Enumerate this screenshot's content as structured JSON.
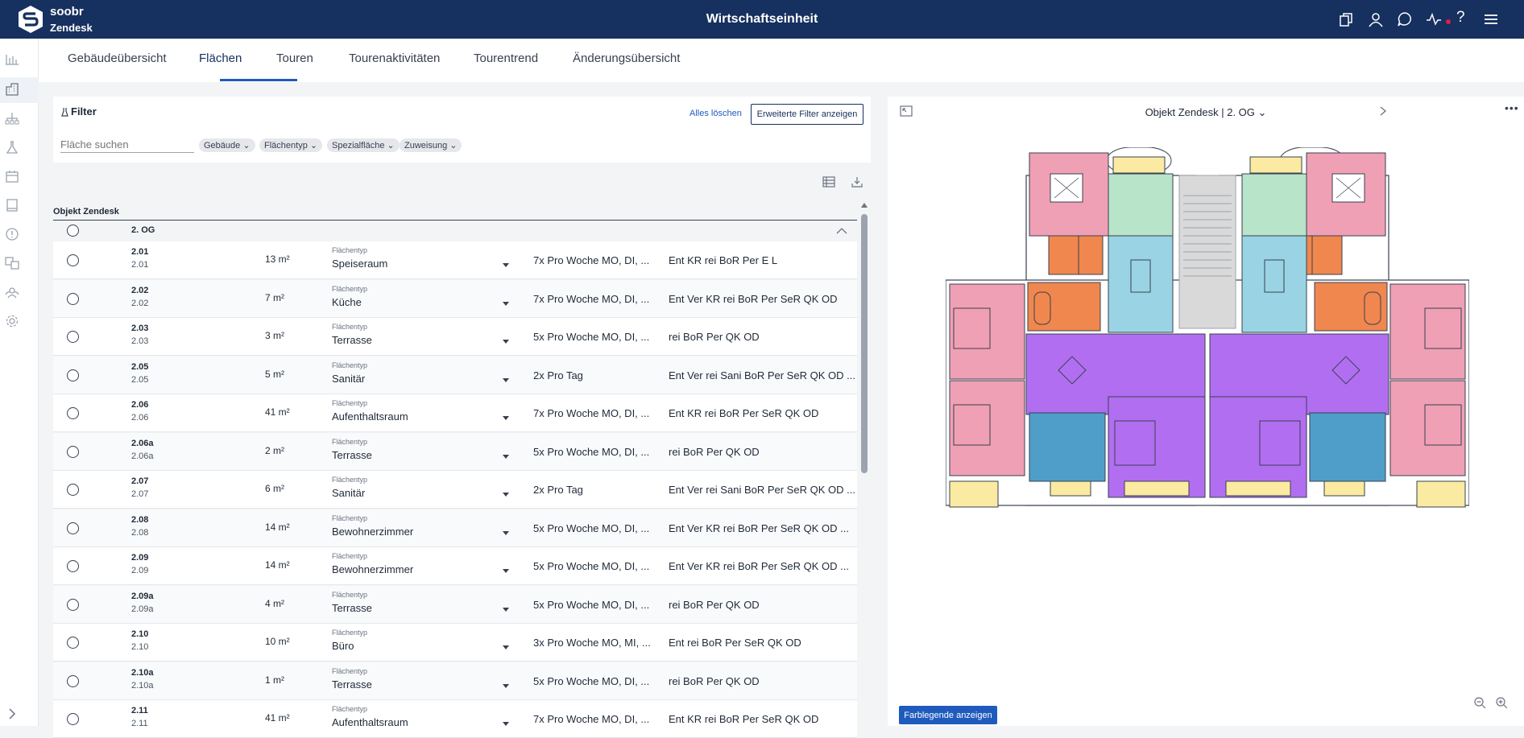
{
  "app": {
    "brand_line1": "soobr",
    "brand_line2": "Zendesk",
    "title": "Wirtschaftseinheit"
  },
  "colors": {
    "topbar": "#16305f",
    "accent": "#1f5bbd",
    "notification_dot": "#e11d48"
  },
  "topbar_icons": [
    "copy-icon",
    "user-icon",
    "chat-icon",
    "activity-icon",
    "help-icon",
    "menu-icon"
  ],
  "topbar_help": "?",
  "sidebar_icons": [
    "chart-icon",
    "building-icon",
    "hierarchy-icon",
    "lab-flask-icon",
    "calendar-icon",
    "book-icon",
    "info-icon",
    "translate-icon",
    "people-icon",
    "settings-icon",
    "expand-chevron-icon"
  ],
  "tabs": [
    {
      "label": "Gebäudeübersicht"
    },
    {
      "label": "Flächen"
    },
    {
      "label": "Touren"
    },
    {
      "label": "Tourenaktivitäten"
    },
    {
      "label": "Tourentrend"
    },
    {
      "label": "Änderungsübersicht"
    }
  ],
  "active_tab": "Flächen",
  "filter": {
    "title": "Filter",
    "clear_all": "Alles löschen",
    "advanced": "Erweiterte Filter anzeigen",
    "search_placeholder": "Fläche suchen",
    "chips": [
      {
        "label": "Gebäude"
      },
      {
        "label": "Flächentyp"
      },
      {
        "label": "Spezialfläche"
      },
      {
        "label": "Zuweisung"
      }
    ]
  },
  "list": {
    "object_header": "Objekt Zendesk",
    "floor": "2. OG",
    "type_label": "Flächentyp",
    "rows": [
      {
        "code": "2.01",
        "sub": "2.01",
        "area": "13 m²",
        "type": "Speiseraum",
        "freq": "7x Pro Woche MO, DI, ...",
        "acts": "Ent KR rei BoR Per E L"
      },
      {
        "code": "2.02",
        "sub": "2.02",
        "area": "7 m²",
        "type": "Küche",
        "freq": "7x Pro Woche MO, DI, ...",
        "acts": "Ent Ver KR rei BoR Per SeR QK OD"
      },
      {
        "code": "2.03",
        "sub": "2.03",
        "area": "3 m²",
        "type": "Terrasse",
        "freq": "5x Pro Woche MO, DI, ...",
        "acts": "rei BoR Per QK OD"
      },
      {
        "code": "2.05",
        "sub": "2.05",
        "area": "5 m²",
        "type": "Sanitär",
        "freq": "2x Pro Tag",
        "acts": "Ent Ver rei Sani BoR Per SeR QK OD ..."
      },
      {
        "code": "2.06",
        "sub": "2.06",
        "area": "41 m²",
        "type": "Aufenthaltsraum",
        "freq": "7x Pro Woche MO, DI, ...",
        "acts": "Ent KR rei BoR Per SeR QK OD"
      },
      {
        "code": "2.06a",
        "sub": "2.06a",
        "area": "2 m²",
        "type": "Terrasse",
        "freq": "5x Pro Woche MO, DI, ...",
        "acts": "rei BoR Per QK OD"
      },
      {
        "code": "2.07",
        "sub": "2.07",
        "area": "6 m²",
        "type": "Sanitär",
        "freq": "2x Pro Tag",
        "acts": "Ent Ver rei Sani BoR Per SeR QK OD ..."
      },
      {
        "code": "2.08",
        "sub": "2.08",
        "area": "14 m²",
        "type": "Bewohnerzimmer",
        "freq": "5x Pro Woche MO, DI, ...",
        "acts": "Ent Ver KR rei BoR Per SeR QK OD ..."
      },
      {
        "code": "2.09",
        "sub": "2.09",
        "area": "14 m²",
        "type": "Bewohnerzimmer",
        "freq": "5x Pro Woche MO, DI, ...",
        "acts": "Ent Ver KR rei BoR Per SeR QK OD ..."
      },
      {
        "code": "2.09a",
        "sub": "2.09a",
        "area": "4 m²",
        "type": "Terrasse",
        "freq": "5x Pro Woche MO, DI, ...",
        "acts": "rei BoR Per QK OD"
      },
      {
        "code": "2.10",
        "sub": "2.10",
        "area": "10 m²",
        "type": "Büro",
        "freq": "3x Pro Woche MO, MI, ...",
        "acts": "Ent rei BoR Per SeR QK OD"
      },
      {
        "code": "2.10a",
        "sub": "2.10a",
        "area": "1 m²",
        "type": "Terrasse",
        "freq": "5x Pro Woche MO, DI, ...",
        "acts": "rei BoR Per QK OD"
      },
      {
        "code": "2.11",
        "sub": "2.11",
        "area": "41 m²",
        "type": "Aufenthaltsraum",
        "freq": "7x Pro Woche MO, DI, ...",
        "acts": "Ent KR rei BoR Per SeR QK OD"
      }
    ]
  },
  "plan": {
    "selector": "Objekt Zendesk | 2. OG",
    "legend_button": "Farblegende anzeigen",
    "room_colors": {
      "bedroom": "#f0a0b4",
      "bath": "#b8e4c9",
      "storage": "#f0874e",
      "lounge": "#9ad4e4",
      "common": "#b26ef0",
      "office": "#4f9ec9",
      "balcony": "#fbeaa1",
      "corridor": "#d9d9d9"
    }
  }
}
